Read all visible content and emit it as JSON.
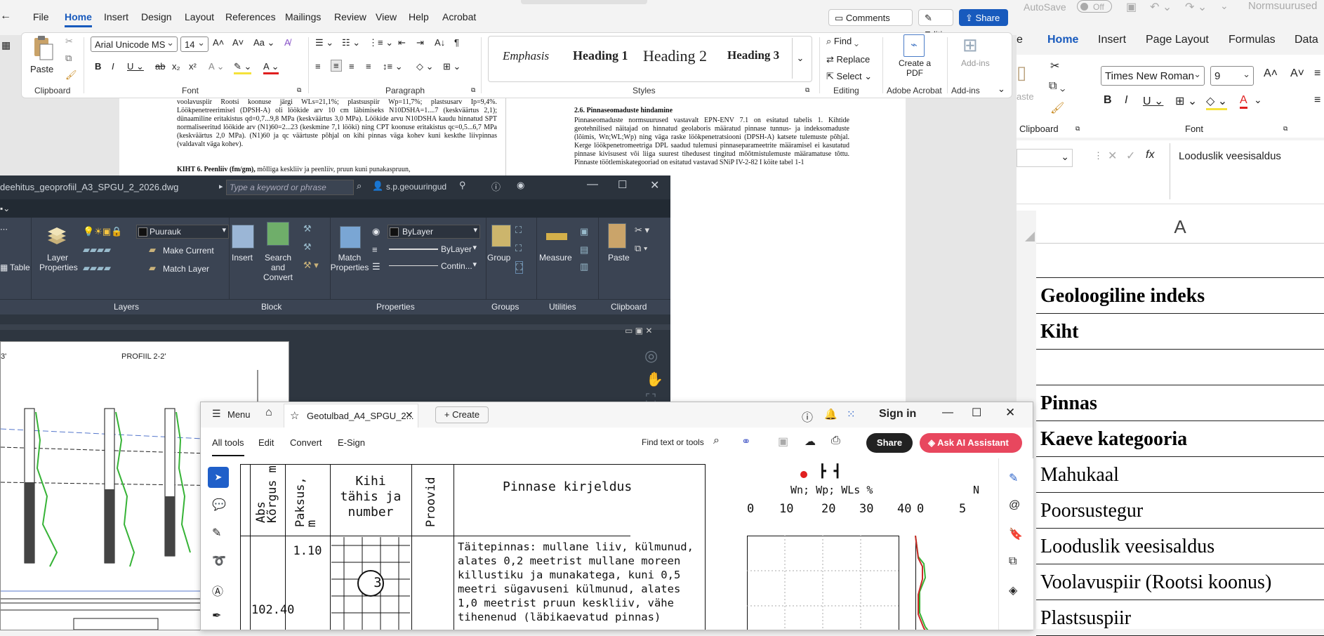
{
  "word": {
    "menu_tabs": [
      "File",
      "Home",
      "Insert",
      "Design",
      "Layout",
      "References",
      "Mailings",
      "Review",
      "View",
      "Help",
      "Acrobat"
    ],
    "active_tab": "Home",
    "comments_label": "Comments",
    "editing_label": "Editing",
    "share_label": "Share",
    "paste_label": "Paste",
    "font_name": "Arial Unicode MS",
    "font_size": "14",
    "group_clipboard": "Clipboard",
    "group_font": "Font",
    "group_paragraph": "Paragraph",
    "group_styles": "Styles",
    "group_editing": "Editing",
    "group_acrobat": "Adobe Acrobat",
    "group_addins": "Add-ins",
    "styles": [
      "Emphasis",
      "Heading 1",
      "Heading 2",
      "Heading 3"
    ],
    "find_label": "Find",
    "replace_label": "Replace",
    "select_label": "Select",
    "create_pdf_label": "Create a PDF",
    "addins_label": "Add-ins",
    "doc_left_p1": "voolavuspiir Rootsi koonuse järgi WLs=21,1%; plastsuspiir Wp=11,7%; plastsusarv Ip=9,4%. Löökpenetreerimisel (DPSH-A) oli löökide arv 10 cm läbimiseks N10DSHA=1....7 (keskväärtus 2,1); dünaamiline eritakistus qd=0,7...9,8 MPa (keskväärtus 3,0 MPa). Löökide arvu N10DSHA kaudu hinnatud SPT normaliseeritud löökide arv (N1)60=2...23 (keskmine 7,1 lööki) ning CPT koonuse eritakistus qc=0,5...6,7 MPa (keskväärtus 2,0 MPa). (N1)60 ja qc väärtuste põhjal on kihi pinnas väga kohev kuni keskthe liivpinnas (valdavalt väga kohev).",
    "doc_left_p2_bold": "KIHT 6. Peenliiv (fm/gm),",
    "doc_left_p2": " mõlliga keskliiv ja peenliiv, pruun kuni punakaspruun,",
    "doc_right_heading": "2.6. Pinnaseomaduste hindamine",
    "doc_right_p": "Pinnaseomaduste normsuurused vastavalt EPN-ENV 7.1 on esitatud tabelis 1. Kihtide geotehnilised näitajad on hinnatud geolaboris määratud pinnase tunnus- ja indeksomaduste (lõimis, Wn;WL;Wp) ning väga raske löökpenetratsiooni (DPSH-A) katsete tulemuste põhjal. Kerge löökpenetromeetriga DPL saadud tulemusi pinnaseparameetrite määramisel ei kasutatud pinnase kivisusest või liiga suurest tihedusest tingitud mõõtmistulemuste määramatuse tõttu. Pinnaste töötlemiskategooriad on esitatud vastavad SNiP IV-2-82 I köite tabel 1-1"
  },
  "excel": {
    "autosave_label": "AutoSave",
    "autosave_state": "Off",
    "file_title": "Normsuurused",
    "menu_tabs": [
      "e",
      "Home",
      "Insert",
      "Page Layout",
      "Formulas",
      "Data"
    ],
    "active_tab": "Home",
    "paste_label": "aste",
    "group_clipboard": "Clipboard",
    "group_font": "Font",
    "font_name": "Times New Roman",
    "font_size": "9",
    "fx_label": "fx",
    "formula_value": "Looduslik veesisaldus",
    "column_header": "A",
    "rows": [
      "",
      "Geoloogiline indeks",
      "Kiht",
      "",
      "Pinnas",
      "Kaeve kategooria",
      "Mahukaal",
      "Poorsustegur",
      "Looduslik veesisaldus",
      "Voolavuspiir (Rootsi koonus)",
      "Plastsuspiir"
    ],
    "bold_rows": [
      1,
      2,
      4,
      5
    ]
  },
  "autocad": {
    "title": "deehitus_geoprofiil_A3_SPGU_2_2026.dwg",
    "search_placeholder": "Type a keyword or phrase",
    "user": "s.p.geouuringud",
    "layer_value": "Puurauk",
    "layer_props_label": "Layer Properties",
    "make_current_label": "Make Current",
    "match_layer_label": "Match Layer",
    "table_label": "Table",
    "insert_label": "Insert",
    "search_convert_label": "Search and Convert",
    "match_props_label": "Match Properties",
    "bylayer1": "ByLayer",
    "bylayer2": "ByLayer",
    "contin": "Contin...",
    "group_label": "Group",
    "measure_label": "Measure",
    "paste_label": "Paste",
    "panels": [
      "Layers",
      "Block",
      "Properties",
      "Groups",
      "Utilities",
      "Clipboard"
    ],
    "profile_title": "PROFIIL 2-2'",
    "profile_left": "3'"
  },
  "acrobat": {
    "menu_label": "Menu",
    "tab_title": "Geotulbad_A4_SPGU_2...",
    "create_label": "Create",
    "sign_in": "Sign in",
    "tools": [
      "All tools",
      "Edit",
      "Convert",
      "E-Sign"
    ],
    "find_label": "Find text or tools",
    "share_label": "Share",
    "ai_label": "Ask AI Assistant",
    "log_headers": {
      "abs": "Abs Kõrgus m",
      "paksus": "Paksus, m",
      "kihi": "Kihi tähis ja number",
      "proovid": "Proovid",
      "kirjeldus": "Pinnase kirjeldus",
      "legend": "Wn; Wp; WLs %",
      "axis": [
        "0",
        "10",
        "20",
        "30",
        "40"
      ],
      "axis2": [
        "0",
        "5"
      ],
      "axis3": "N"
    },
    "layer_thickness": "1.10",
    "layer_number": "3",
    "abs_value": "102.40",
    "description": "Täitepinnas: mullane liiv, külmunud, alates 0,2 meetrist mullane moreen killustiku ja munakatega, kuni 0,5 meetri sügavuseni külmunud, alates 1,0 meetrist pruun keskliiv, vähe tihenenud (läbikaevatud pinnas)"
  }
}
